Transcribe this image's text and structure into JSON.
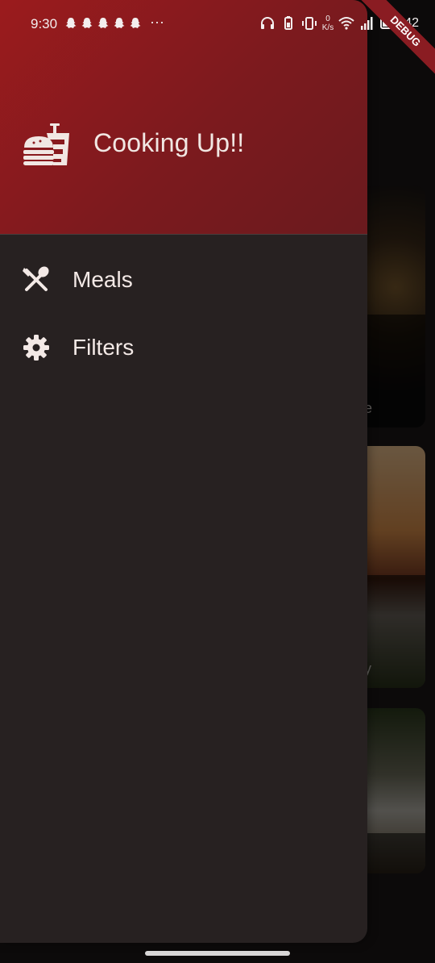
{
  "status_bar": {
    "time": "9:30",
    "more": "···",
    "net_speed_value": "0",
    "net_speed_unit": "K/s",
    "battery": "42"
  },
  "debug_label": "DEBUG",
  "drawer": {
    "header_title": "Cooking Up!!",
    "items": [
      {
        "label": "Meals",
        "icon": "fork-spoon-icon"
      },
      {
        "label": "Filters",
        "icon": "gear-icon"
      }
    ]
  },
  "background": {
    "card1_fragment": "e",
    "card2_fragment": "y"
  },
  "colors": {
    "header_red": "#9b1b1d",
    "drawer_bg": "#272121",
    "text": "#f3e9e6"
  }
}
